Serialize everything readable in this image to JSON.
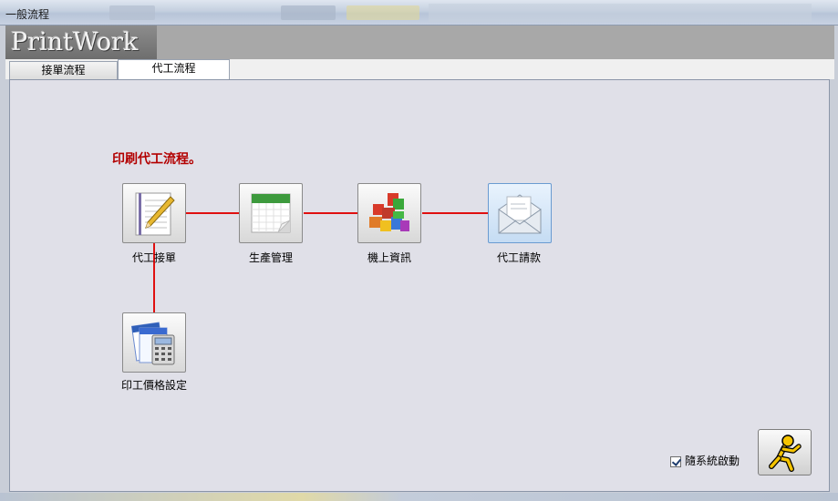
{
  "window": {
    "title": "一般流程"
  },
  "logo": {
    "text": "PrintWork"
  },
  "tabs": [
    {
      "label": "接單流程",
      "selected": false
    },
    {
      "label": "代工流程",
      "selected": true
    }
  ],
  "main": {
    "heading": "印刷代工流程。",
    "nodes": [
      {
        "label": "代工接單",
        "icon": "notepad-pencil-icon"
      },
      {
        "label": "生產管理",
        "icon": "calendar-icon"
      },
      {
        "label": "機上資訊",
        "icon": "colored-blocks-icon"
      },
      {
        "label": "代工請款",
        "icon": "envelope-icon"
      },
      {
        "label": "印工價格設定",
        "icon": "calculator-icon"
      }
    ],
    "autostart": {
      "label": "隨系統啟動",
      "checked": true
    },
    "run_button": {
      "icon": "running-man-icon"
    }
  },
  "colors": {
    "heading": "#b30000",
    "connector": "#e01010",
    "active_node": "#c5dcf3"
  }
}
